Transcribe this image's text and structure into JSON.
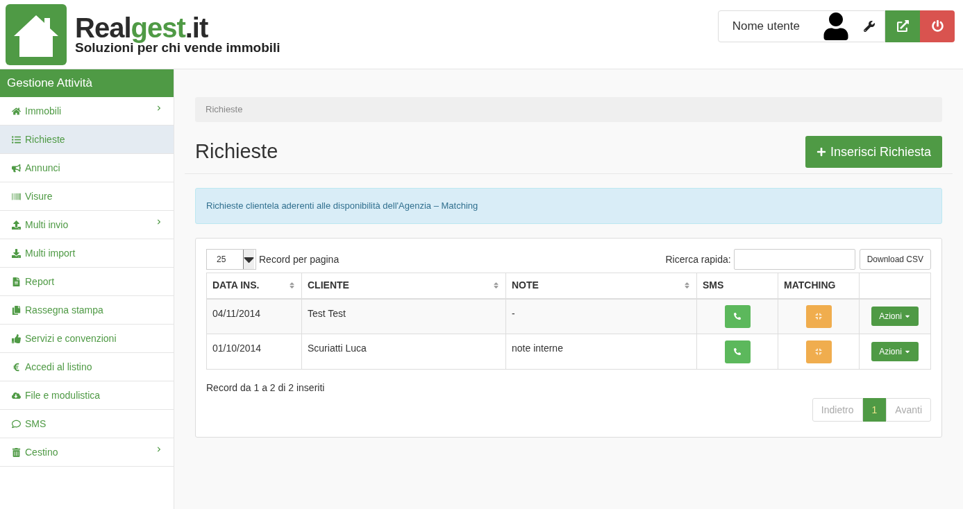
{
  "logo": {
    "brand": [
      {
        "text": "Real",
        "color": "#2b2b2b"
      },
      {
        "text": "gest",
        "color": "#4f9a45"
      },
      {
        "text": ".it",
        "color": "#2b2b2b"
      }
    ],
    "tagline": "Soluzioni per chi vende immobili"
  },
  "user_menu": {
    "username": "Nome utente"
  },
  "sidebar": {
    "title": "Gestione Attività",
    "items": [
      {
        "label": "Immobili",
        "selected": false,
        "expandable": true
      },
      {
        "label": "Richieste",
        "selected": true,
        "expandable": false
      },
      {
        "label": "Annunci",
        "selected": false,
        "expandable": false
      },
      {
        "label": "Visure",
        "selected": false,
        "expandable": false
      },
      {
        "label": "Multi invio",
        "selected": false,
        "expandable": true
      },
      {
        "label": "Multi import",
        "selected": false,
        "expandable": false
      },
      {
        "label": "Report",
        "selected": false,
        "expandable": false
      },
      {
        "label": "Rassegna stampa",
        "selected": false,
        "expandable": false
      },
      {
        "label": "Servizi e convenzioni",
        "selected": false,
        "expandable": false
      },
      {
        "label": "Accedi al listino",
        "selected": false,
        "expandable": false
      },
      {
        "label": "File e modulistica",
        "selected": false,
        "expandable": false
      },
      {
        "label": "SMS",
        "selected": false,
        "expandable": false
      },
      {
        "label": "Cestino",
        "selected": false,
        "expandable": true
      }
    ]
  },
  "breadcrumb": [
    "Richieste"
  ],
  "page_title": "Richieste",
  "add_button": "Inserisci Richiesta",
  "info_alert": "Richieste clientela aderenti alle disponibilità dell'Agenzia – Matching",
  "table_controls": {
    "page_size": "25",
    "page_size_label": "Record per pagina",
    "search_label": "Ricerca rapida:",
    "download_button": "Download CSV"
  },
  "table": {
    "columns": [
      {
        "label": "DATA INS.",
        "sortable": true
      },
      {
        "label": "CLIENTE",
        "sortable": true
      },
      {
        "label": "NOTE",
        "sortable": true
      },
      {
        "label": "SMS",
        "sortable": false
      },
      {
        "label": "MATCHING",
        "sortable": false
      },
      {
        "sortable": false
      }
    ],
    "rows": [
      {
        "date": "04/11/2014",
        "client": "Test Test",
        "note": "-",
        "action": "Azioni"
      },
      {
        "date": "01/10/2014",
        "client": "Scuriatti Luca",
        "note": "note interne",
        "action": "Azioni"
      }
    ]
  },
  "table_info": "Record da 1 a 2 di 2 inseriti",
  "pagination": [
    {
      "label": "Indietro",
      "selected": false,
      "disabled": true
    },
    {
      "label": "1",
      "selected": true,
      "disabled": false
    },
    {
      "label": "Avanti",
      "selected": false,
      "disabled": true
    }
  ]
}
